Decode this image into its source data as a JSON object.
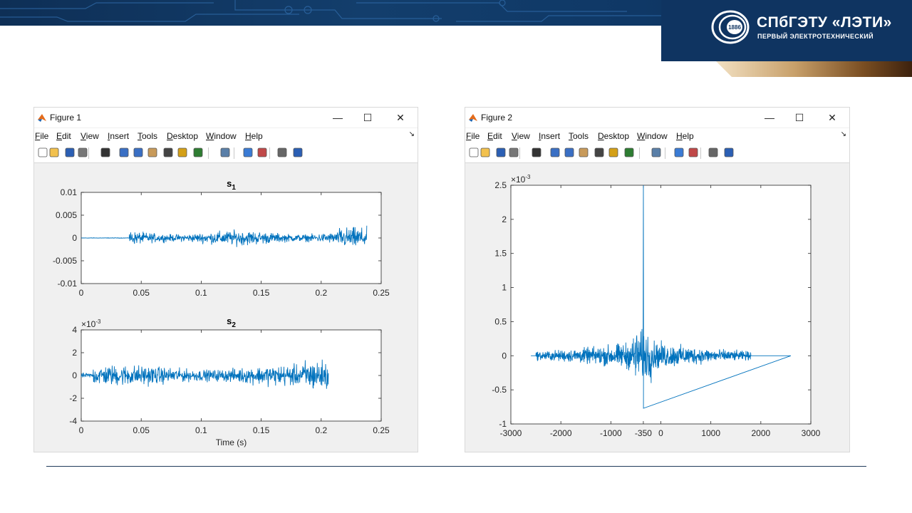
{
  "header": {
    "university_name": "СПбГЭТУ «ЛЭТИ»",
    "university_subtitle": "ПЕРВЫЙ ЭЛЕКТРОТЕХНИЧЕСКИЙ",
    "emblem_year": "1886",
    "colors": {
      "banner": "#0f3461",
      "accent_gold": "#c8a06a"
    }
  },
  "windows": [
    {
      "title": "Figure 1",
      "menu": [
        "File",
        "Edit",
        "View",
        "Insert",
        "Tools",
        "Desktop",
        "Window",
        "Help"
      ],
      "menu_mnemonics": [
        "F",
        "E",
        "V",
        "I",
        "T",
        "D",
        "W",
        "H"
      ],
      "toolbar_icons": [
        "new-figure-icon",
        "open-file-icon",
        "save-icon",
        "print-icon",
        "pointer-icon",
        "zoom-in-icon",
        "zoom-out-icon",
        "pan-icon",
        "rotate-3d-icon",
        "data-cursor-icon",
        "brush-icon",
        "link-plot-icon",
        "colorbar-icon",
        "legend-icon",
        "hide-tools-icon",
        "dock-icon"
      ],
      "window_buttons": {
        "minimize": "—",
        "maximize": "☐",
        "close": "✕"
      }
    },
    {
      "title": "Figure 2",
      "menu": [
        "File",
        "Edit",
        "View",
        "Insert",
        "Tools",
        "Desktop",
        "Window",
        "Help"
      ],
      "menu_mnemonics": [
        "F",
        "E",
        "V",
        "I",
        "T",
        "D",
        "W",
        "H"
      ],
      "toolbar_icons": [
        "new-figure-icon",
        "open-file-icon",
        "save-icon",
        "print-icon",
        "pointer-icon",
        "zoom-in-icon",
        "zoom-out-icon",
        "pan-icon",
        "rotate-3d-icon",
        "data-cursor-icon",
        "brush-icon",
        "link-plot-icon",
        "colorbar-icon",
        "legend-icon",
        "hide-tools-icon",
        "dock-icon"
      ],
      "window_buttons": {
        "minimize": "—",
        "maximize": "☐",
        "close": "✕"
      }
    }
  ],
  "chart_data": [
    {
      "type": "line",
      "title": "s",
      "title_subscript": "1",
      "xlabel": "",
      "ylabel": "",
      "xlim": [
        0,
        0.25
      ],
      "ylim": [
        -0.01,
        0.01
      ],
      "xticks": [
        0,
        0.05,
        0.1,
        0.15,
        0.2,
        0.25
      ],
      "xtick_labels": [
        "0",
        "0.05",
        "0.1",
        "0.15",
        "0.2",
        "0.25"
      ],
      "yticks": [
        0.01,
        0.005,
        0,
        -0.005,
        -0.01
      ],
      "ytick_labels": [
        "0.01",
        "0.005",
        "0",
        "-0.005",
        "-0.01"
      ],
      "line_color": "#0072bd",
      "series": [
        {
          "x_range": [
            0,
            0.238
          ],
          "onset": 0.04,
          "peak_amplitude": 0.005,
          "min": -0.0048,
          "max": 0.005,
          "burst_region": [
            0.215,
            0.238
          ]
        }
      ]
    },
    {
      "type": "line",
      "title": "s",
      "title_subscript": "2",
      "xlabel": "Time (s)",
      "ylabel": "",
      "y_exponent": "×10",
      "y_exponent_power": "-3",
      "xlim": [
        0,
        0.25
      ],
      "ylim": [
        -4,
        4
      ],
      "xticks": [
        0,
        0.05,
        0.1,
        0.15,
        0.2,
        0.25
      ],
      "xtick_labels": [
        "0",
        "0.05",
        "0.1",
        "0.15",
        "0.2",
        "0.25"
      ],
      "yticks": [
        4,
        2,
        0,
        -2,
        -4
      ],
      "ytick_labels": [
        "4",
        "2",
        "0",
        "-2",
        "-4"
      ],
      "line_color": "#0072bd",
      "series": [
        {
          "x_range": [
            0,
            0.206
          ],
          "onset": 0.0,
          "min": -2.9,
          "max": 2.7,
          "burst_region": [
            0.185,
            0.206
          ]
        }
      ]
    },
    {
      "type": "line",
      "title": "",
      "xlabel": "",
      "ylabel": "",
      "y_exponent": "×10",
      "y_exponent_power": "-3",
      "xlim": [
        -3000,
        3000
      ],
      "ylim": [
        -1,
        2.5
      ],
      "xticks": [
        -3000,
        -2000,
        -1000,
        -350,
        0,
        1000,
        2000,
        3000
      ],
      "xtick_labels": [
        "-3000",
        "-2000",
        "-1000",
        "-350",
        "0",
        "1000",
        "2000",
        "3000"
      ],
      "yticks": [
        2.5,
        2,
        1.5,
        1,
        0.5,
        0,
        -0.5,
        -1
      ],
      "ytick_labels": [
        "2.5",
        "2",
        "1.5",
        "1",
        "0.5",
        "0",
        "-0.5",
        "-1"
      ],
      "line_color": "#0072bd",
      "series": [
        {
          "x_range": [
            -2600,
            2600
          ],
          "active_range": [
            -2500,
            1800
          ],
          "peak_x": -350,
          "peak_y": 2.5,
          "min": -0.77,
          "side_max": 0.57
        }
      ]
    }
  ]
}
